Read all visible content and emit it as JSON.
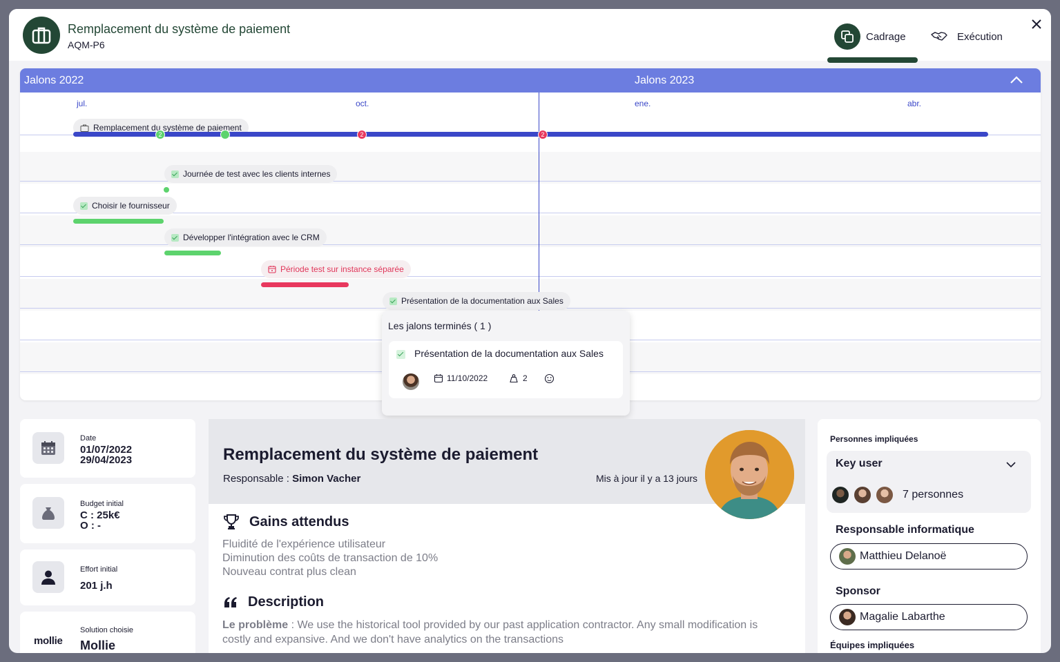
{
  "header": {
    "title": "Remplacement du système de paiement",
    "code": "AQM-P6",
    "tabs": [
      {
        "label": "Cadrage",
        "active": true
      },
      {
        "label": "Exécution",
        "active": false
      }
    ]
  },
  "timeline": {
    "year_left": "Jalons 2022",
    "year_right": "Jalons 2023",
    "months": [
      "jul.",
      "oct.",
      "ene.",
      "abr."
    ],
    "project_chip": "Remplacement du système de paiement",
    "badges": [
      "2",
      "2",
      "2"
    ],
    "milestones": [
      {
        "label": "Journée de test avec les clients internes",
        "status": "done"
      },
      {
        "label": "Choisir le fournisseur",
        "status": "done"
      },
      {
        "label": "Développer l'intégration avec le CRM",
        "status": "done"
      },
      {
        "label": "Période test sur instance séparée",
        "status": "late"
      },
      {
        "label": "Présentation de la documentation aux Sales",
        "status": "done"
      }
    ],
    "colors": {
      "header": "#6c7de0",
      "main_bar": "#3a47c8",
      "done": "#5dd36d",
      "late": "#e8385e"
    }
  },
  "popover": {
    "title": "Les jalons terminés ( 1 )",
    "item": {
      "name": "Présentation de la documentation aux Sales",
      "date": "11/10/2022",
      "effort": "2"
    }
  },
  "left_cards": {
    "date": {
      "label": "Date",
      "start": "01/07/2022",
      "end": "29/04/2023"
    },
    "budget": {
      "label": "Budget initial",
      "c": "C : 25k€",
      "o": "O : -"
    },
    "effort": {
      "label": "Effort initial",
      "value": "201 j.h"
    },
    "solution": {
      "label": "Solution choisie",
      "logo": "mollie",
      "value": "Mollie"
    }
  },
  "project": {
    "title": "Remplacement du système de paiement",
    "responsable_label": "Responsable : ",
    "responsable_name": "Simon Vacher",
    "updated": "Mis à jour il y a 13 jours",
    "gains_title": "Gains attendus",
    "gains": [
      "Fluidité de l'expérience utilisateur",
      "Diminution des coûts de transaction de 10%",
      "Nouveau contrat plus clean"
    ],
    "description_title": "Description",
    "problem_label": "Le problème",
    "problem_text": " : We use the historical tool provided by our past application contractor. Any small modification is costly and expansive. And we don't have analytics on the transactions"
  },
  "people": {
    "title": "Personnes impliquées",
    "key_user_label": "Key user",
    "key_user_count": "7 personnes",
    "it_label": "Responsable informatique",
    "it_name": "Matthieu Delanoë",
    "sponsor_label": "Sponsor",
    "sponsor_name": "Magalie Labarthe",
    "teams_label": "Équipes impliquées"
  }
}
